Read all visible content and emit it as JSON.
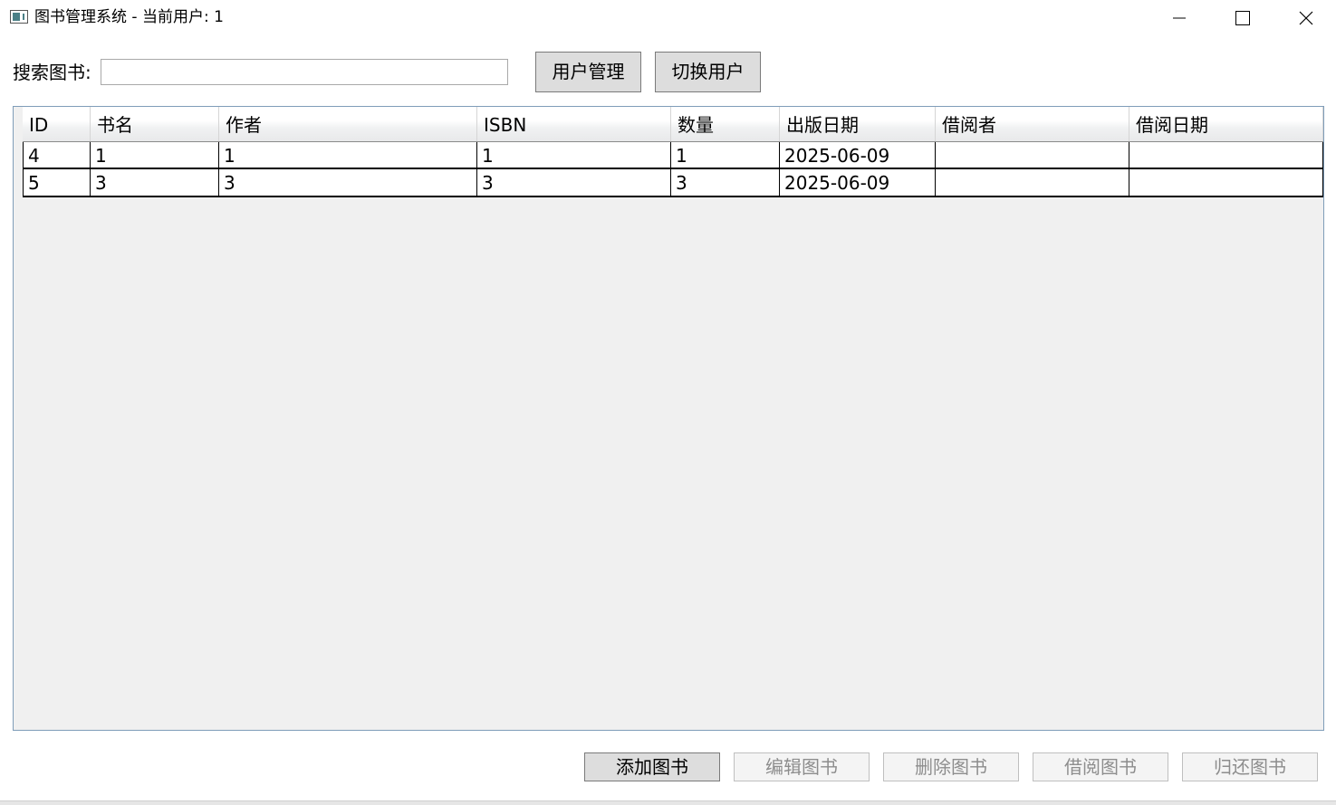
{
  "window": {
    "title": "图书管理系统 - 当前用户: 1"
  },
  "search": {
    "label": "搜索图书:",
    "value": "",
    "placeholder": ""
  },
  "toolbar": {
    "user_management": "用户管理",
    "switch_user": "切换用户"
  },
  "table": {
    "columns": [
      "ID",
      "书名",
      "作者",
      "ISBN",
      "数量",
      "出版日期",
      "借阅者",
      "借阅日期"
    ],
    "rows": [
      [
        "4",
        "1",
        "1",
        "1",
        "1",
        "2025-06-09",
        "",
        ""
      ],
      [
        "5",
        "3",
        "3",
        "3",
        "3",
        "2025-06-09",
        "",
        ""
      ]
    ]
  },
  "actions": {
    "add_book": "添加图书",
    "edit_book": "编辑图书",
    "delete_book": "删除图书",
    "borrow_book": "借阅图书",
    "return_book": "归还图书"
  },
  "colors": {
    "button_face": "#dddddd",
    "disabled_text": "#8d8d8d",
    "grid_background": "#f0f0f0",
    "grid_border": "#7f9db9"
  },
  "icons": {
    "app": "app-window-icon",
    "minimize": "minimize-icon",
    "maximize": "maximize-icon",
    "close": "close-icon"
  }
}
